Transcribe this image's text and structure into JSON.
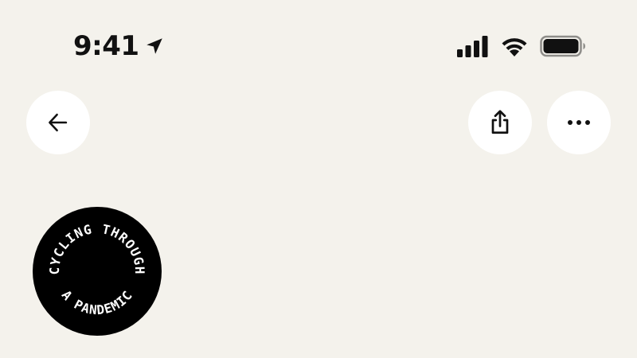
{
  "status_bar": {
    "time": "9:41",
    "icons": [
      "location-arrow-icon",
      "cellular-signal-icon",
      "wifi-icon",
      "battery-icon"
    ]
  },
  "header": {
    "back_icon": "arrow-left-icon",
    "share_icon": "share-icon",
    "more_icon": "ellipsis-icon"
  },
  "podcast": {
    "badge_line1": "CYCLING THROUGH",
    "badge_line2": "A PANDEMIC"
  },
  "colors": {
    "background": "#f4f2ec",
    "button_bg": "#ffffff",
    "badge_bg": "#000000",
    "text": "#111111"
  }
}
